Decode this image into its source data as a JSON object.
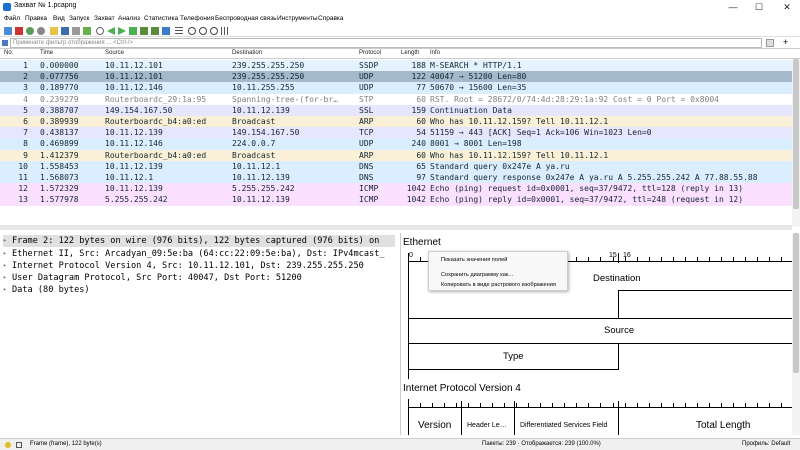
{
  "title": "Захват № 1.pcapng",
  "window_controls": {
    "min": "—",
    "max": "☐",
    "close": "✕"
  },
  "menu": [
    "Файл",
    "Правка",
    "Вид",
    "Запуск",
    "Захват",
    "Анализ",
    "Статистика",
    "Телефония",
    "Беспроводная связь",
    "Инструменты",
    "Справка"
  ],
  "filter": {
    "placeholder": "Примените фильтр отображения ... <Ctrl-/>",
    "add": "+"
  },
  "columns": [
    "No.",
    "Time",
    "Source",
    "Destination",
    "Protocol",
    "Length",
    "Info"
  ],
  "packets": [
    {
      "no": "1",
      "time": "0.000000",
      "src": "10.11.12.101",
      "dst": "239.255.255.250",
      "proto": "SSDP",
      "len": "188",
      "info": "M-SEARCH * HTTP/1.1",
      "bg": "#e6f2ff",
      "fg": "#12272e"
    },
    {
      "no": "2",
      "time": "0.077756",
      "src": "10.11.12.101",
      "dst": "239.255.255.250",
      "proto": "UDP",
      "len": "122",
      "info": "40047 → 51200 Len=80",
      "bg": "#a4b9cb",
      "fg": "#12272e"
    },
    {
      "no": "3",
      "time": "0.189770",
      "src": "10.11.12.146",
      "dst": "10.11.255.255",
      "proto": "UDP",
      "len": "77",
      "info": "50670 → 15600 Len=35",
      "bg": "#dbeeff",
      "fg": "#12272e"
    },
    {
      "no": "4",
      "time": "0.239279",
      "src": "Routerboardc_29:1a:95",
      "dst": "Spanning-tree-(for-br…",
      "proto": "STP",
      "len": "60",
      "info": "RST. Root = 28672/0/74:4d:28:29:1a:92  Cost = 0  Port = 0x8004",
      "bg": "#ffffff",
      "fg": "#7f7f7f"
    },
    {
      "no": "5",
      "time": "0.388707",
      "src": "149.154.167.50",
      "dst": "10.11.12.139",
      "proto": "SSL",
      "len": "159",
      "info": "Continuation Data",
      "bg": "#e7e6ff",
      "fg": "#12272e"
    },
    {
      "no": "6",
      "time": "0.389939",
      "src": "Routerboardc_b4:a0:ed",
      "dst": "Broadcast",
      "proto": "ARP",
      "len": "60",
      "info": "Who has 10.11.12.159? Tell 10.11.12.1",
      "bg": "#faf0d7",
      "fg": "#12272e"
    },
    {
      "no": "7",
      "time": "0.438137",
      "src": "10.11.12.139",
      "dst": "149.154.167.50",
      "proto": "TCP",
      "len": "54",
      "info": "51159 → 443 [ACK] Seq=1 Ack=106 Win=1023 Len=0",
      "bg": "#e7e6ff",
      "fg": "#12272e"
    },
    {
      "no": "8",
      "time": "0.469899",
      "src": "10.11.12.146",
      "dst": "224.0.0.7",
      "proto": "UDP",
      "len": "240",
      "info": "8001 → 8001 Len=198",
      "bg": "#dbeeff",
      "fg": "#12272e"
    },
    {
      "no": "9",
      "time": "1.412379",
      "src": "Routerboardc_b4:a0:ed",
      "dst": "Broadcast",
      "proto": "ARP",
      "len": "60",
      "info": "Who has 10.11.12.159? Tell 10.11.12.1",
      "bg": "#faf0d7",
      "fg": "#12272e"
    },
    {
      "no": "10",
      "time": "1.558453",
      "src": "10.11.12.139",
      "dst": "10.11.12.1",
      "proto": "DNS",
      "len": "65",
      "info": "Standard query 0x247e A ya.ru",
      "bg": "#dbeeff",
      "fg": "#12272e"
    },
    {
      "no": "11",
      "time": "1.568073",
      "src": "10.11.12.1",
      "dst": "10.11.12.139",
      "proto": "DNS",
      "len": "97",
      "info": "Standard query response 0x247e A ya.ru A 5.255.255.242 A 77.88.55.88",
      "bg": "#dbeeff",
      "fg": "#12272e"
    },
    {
      "no": "12",
      "time": "1.572329",
      "src": "10.11.12.139",
      "dst": "5.255.255.242",
      "proto": "ICMP",
      "len": "1042",
      "info": "Echo (ping) request  id=0x0001, seq=37/9472, ttl=128 (reply in 13)",
      "bg": "#fce0ff",
      "fg": "#12272e"
    },
    {
      "no": "13",
      "time": "1.577978",
      "src": "5.255.255.242",
      "dst": "10.11.12.139",
      "proto": "ICMP",
      "len": "1042",
      "info": "Echo (ping) reply    id=0x0001, seq=37/9472, ttl=248 (request in 12)",
      "bg": "#fce0ff",
      "fg": "#12272e"
    }
  ],
  "details": [
    "Frame 2: 122 bytes on wire (976 bits), 122 bytes captured (976 bits) on",
    "Ethernet II, Src: Arcadyan_09:5e:ba (64:cc:22:09:5e:ba), Dst: IPv4mcast_",
    "Internet Protocol Version 4, Src: 10.11.12.101, Dst: 239.255.255.250",
    "User Datagram Protocol, Src Port: 40047, Dst Port: 51200",
    "Data (80 bytes)"
  ],
  "diagram": {
    "eth_title": "Ethernet",
    "bit0": "0",
    "bit15": "15",
    "bit16": "16",
    "destination": "Destination",
    "source": "Source",
    "type": "Type",
    "ip_title": "Internet Protocol Version 4",
    "version": "Version",
    "header_len": "Header Le…",
    "dsf": "Differentiated Services Field",
    "total_len": "Total Length"
  },
  "context_menu": [
    "Показать значения полей",
    "Сохранить диаграмму как...",
    "Копировать в виде растрового изображения"
  ],
  "status": {
    "frame": "Frame (frame), 122 byte(s)",
    "packets": "Пакеты: 239 · Отображается: 239 (100.0%)",
    "profile": "Профиль: Default"
  }
}
